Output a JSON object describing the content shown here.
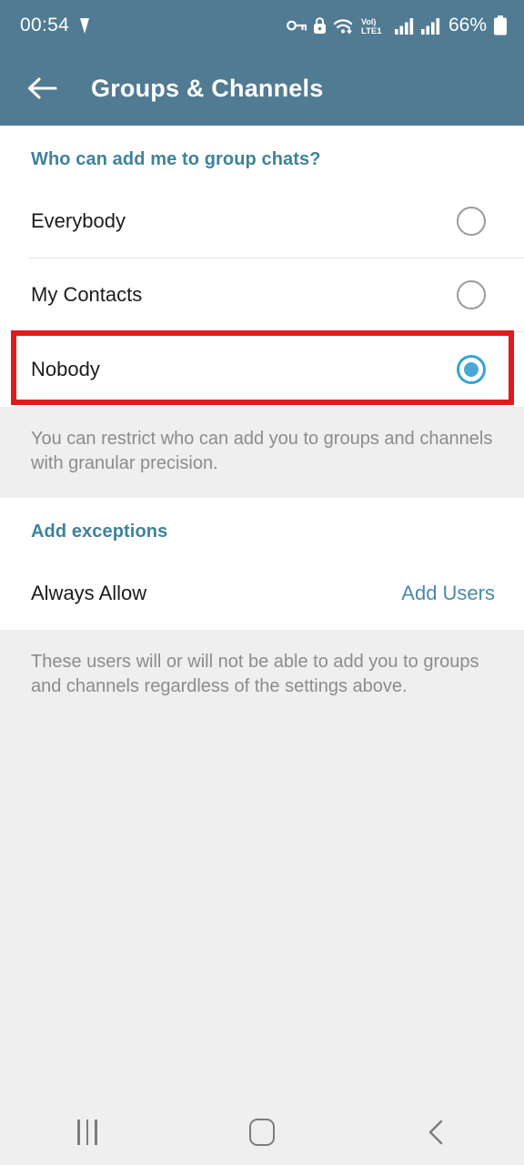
{
  "status_bar": {
    "clock": "00:54",
    "battery_percent": "66%",
    "icons": [
      "location-arrow-icon",
      "key-icon",
      "lock-icon",
      "wifi-icon",
      "volte1-icon",
      "signal-bars-icon",
      "signal-bars-icon",
      "battery-icon"
    ],
    "network_label": "VoL",
    "network_sub": "LTE1",
    "background_color": "#517b92"
  },
  "app_bar": {
    "back_label": "back-arrow",
    "title": "Groups & Channels"
  },
  "privacy_section": {
    "heading": "Who can add me to group chats?",
    "options": [
      {
        "label": "Everybody",
        "selected": false
      },
      {
        "label": "My Contacts",
        "selected": false
      },
      {
        "label": "Nobody",
        "selected": true
      }
    ],
    "footnote": "You can restrict who can add you to groups and channels with granular precision."
  },
  "exceptions_section": {
    "heading": "Add exceptions",
    "row_label": "Always Allow",
    "action_label": "Add Users",
    "footnote": "These users will or will not be able to add you to groups and channels regardless of the settings above."
  },
  "highlight": {
    "color": "#e01b1b",
    "target": "Nobody"
  },
  "nav_bar": {
    "recents_label": "recents-button",
    "home_label": "home-button",
    "back_label": "back-button"
  },
  "colors": {
    "header": "#517b92",
    "accent_teal": "#3f8299",
    "radio_blue": "#35a4d6",
    "link": "#4a8aa8",
    "page_bg": "#efefef"
  }
}
